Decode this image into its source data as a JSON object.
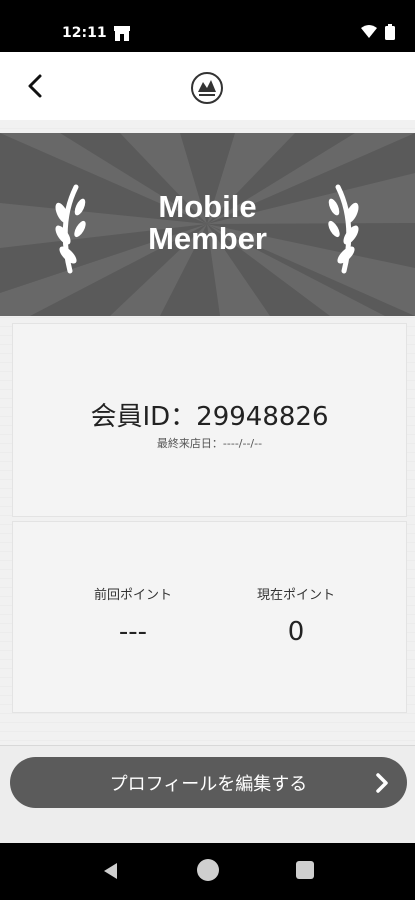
{
  "status_bar": {
    "time": "12:11"
  },
  "banner": {
    "line1": "Mobile",
    "line2": "Member"
  },
  "member": {
    "id_text": "会員ID：29948826",
    "last_visit": "最終来店日：----/--/--"
  },
  "points": {
    "previous_label": "前回ポイント",
    "previous_value": "---",
    "current_label": "現在ポイント",
    "current_value": "0"
  },
  "actions": {
    "edit_profile": "プロフィールを編集する"
  },
  "icons": {
    "back": "back-arrow-icon",
    "logo": "logo-icon",
    "chevron": "chevron-right-icon",
    "wifi": "wifi-icon",
    "battery": "battery-icon",
    "store": "store-icon",
    "laurel": "laurel-icon",
    "nav_back": "triangle-back-icon",
    "nav_home": "circle-home-icon",
    "nav_recent": "square-recent-icon"
  },
  "colors": {
    "banner": "#5a5a5a",
    "button": "#5b5b5b"
  }
}
